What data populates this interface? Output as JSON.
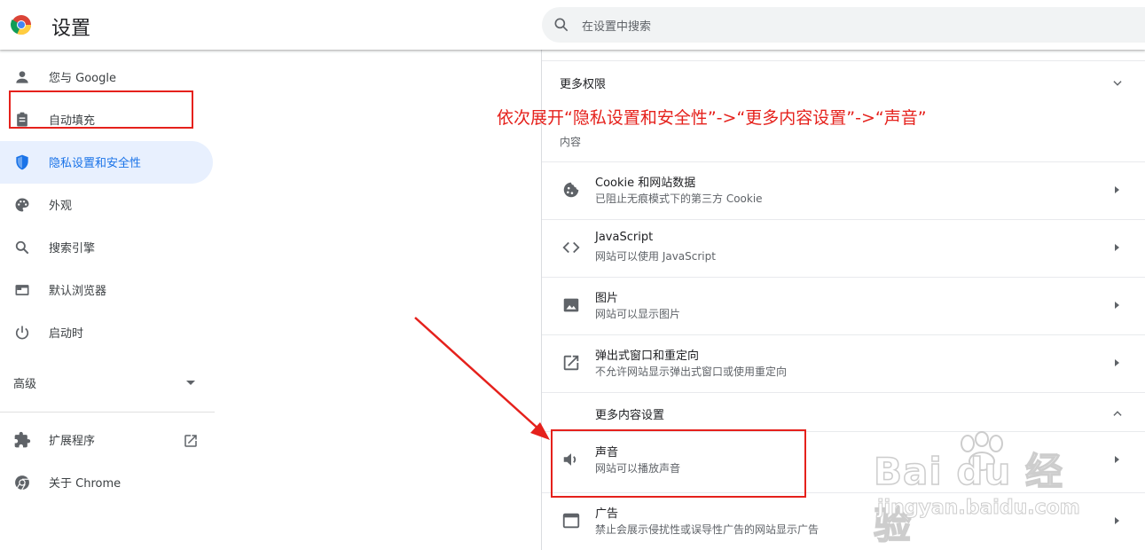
{
  "app": {
    "title": "设置",
    "search_placeholder": "在设置中搜索"
  },
  "sidebar": {
    "items": [
      {
        "label": "您与 Google",
        "icon": "person-icon"
      },
      {
        "label": "自动填充",
        "icon": "clipboard-icon"
      },
      {
        "label": "隐私设置和安全性",
        "icon": "shield-icon",
        "active": true
      },
      {
        "label": "外观",
        "icon": "palette-icon"
      },
      {
        "label": "搜索引擎",
        "icon": "search-icon"
      },
      {
        "label": "默认浏览器",
        "icon": "browser-icon"
      },
      {
        "label": "启动时",
        "icon": "power-icon"
      }
    ],
    "advanced_label": "高级",
    "extensions_label": "扩展程序",
    "about_label": "关于 Chrome"
  },
  "main": {
    "more_permissions_title": "更多权限",
    "content_subhead": "内容",
    "rows": [
      {
        "title": "Cookie 和网站数据",
        "subtitle": "已阻止无痕模式下的第三方 Cookie",
        "icon": "cookie-icon"
      },
      {
        "title": "JavaScript",
        "subtitle": "网站可以使用 JavaScript",
        "icon": "code-icon"
      },
      {
        "title": "图片",
        "subtitle": "网站可以显示图片",
        "icon": "image-icon"
      },
      {
        "title": "弹出式窗口和重定向",
        "subtitle": "不允许网站显示弹出式窗口或使用重定向",
        "icon": "open-in-new-icon"
      }
    ],
    "more_content_title": "更多内容设置",
    "more_rows": [
      {
        "title": "声音",
        "subtitle": "网站可以播放声音",
        "icon": "volume-icon"
      },
      {
        "title": "广告",
        "subtitle": "禁止会展示侵扰性或误导性广告的网站显示广告",
        "icon": "ads-window-icon"
      }
    ]
  },
  "annotation": {
    "instruction": "依次展开“隐私设置和安全性”->“更多内容设置”->“声音”",
    "color": "#e5211c"
  },
  "watermark": {
    "brand": "Bai du 经验",
    "url": "jingyan.baidu.com"
  },
  "colors": {
    "accent": "#1a73e8",
    "active_bg": "#e8f0fe",
    "annotation_red": "#e5211c"
  }
}
